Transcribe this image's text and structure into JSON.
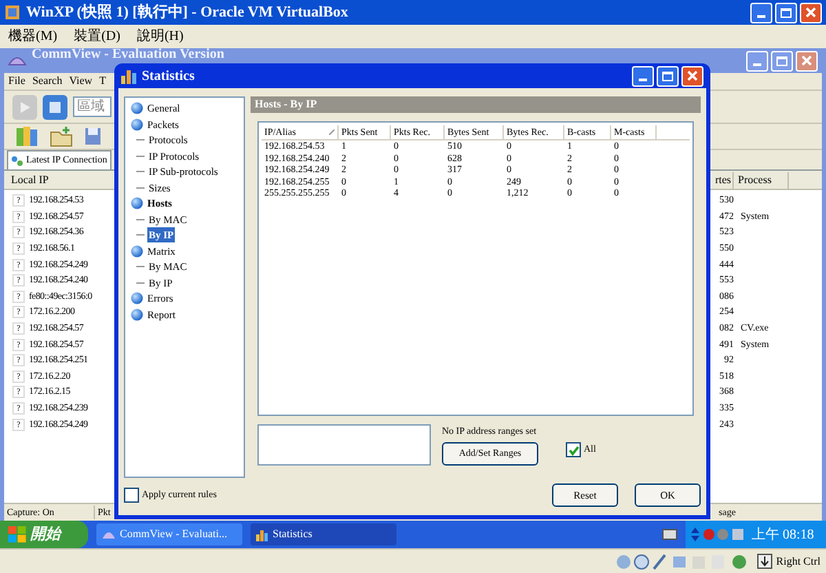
{
  "vbox": {
    "title": "WinXP (快照 1) [執行中] - Oracle VM VirtualBox",
    "menu": [
      "機器(M)",
      "裝置(D)",
      "說明(H)"
    ],
    "host_key": "Right Ctrl"
  },
  "commview": {
    "title": "CommView - Evaluation Version",
    "menu": [
      "File",
      "Search",
      "View",
      "T"
    ],
    "adapter_field": "區域",
    "tab": "Latest IP Connection",
    "columns": [
      "Local IP",
      "rtes",
      "Process"
    ],
    "rows": [
      {
        "icon": "?",
        "local_ip": "192.168.254.53",
        "column_2": "530"
      },
      {
        "icon": "?",
        "local_ip": "192.168.254.57",
        "column_2": "472",
        "process": "System"
      },
      {
        "icon": "?",
        "local_ip": "192.168.254.36",
        "column_2": "523"
      },
      {
        "icon": "?",
        "local_ip": "192.168.56.1",
        "column_2": "550"
      },
      {
        "icon": "?",
        "local_ip": "192.168.254.249",
        "column_2": "444"
      },
      {
        "icon": "?",
        "local_ip": "192.168.254.240",
        "column_2": "553"
      },
      {
        "icon": "?",
        "local_ip": "fe80::49ec:3156:0",
        "column_2": "086"
      },
      {
        "icon": "?",
        "local_ip": "172.16.2.200",
        "column_2": "254"
      },
      {
        "icon": "?",
        "local_ip": "192.168.254.57",
        "column_2": "082",
        "process": "CV.exe"
      },
      {
        "icon": "?",
        "local_ip": "192.168.254.57",
        "column_2": "491",
        "process": "System"
      },
      {
        "icon": "?",
        "local_ip": "192.168.254.251",
        "column_2": "92"
      },
      {
        "icon": "?",
        "local_ip": "172.16.2.20",
        "column_2": "518"
      },
      {
        "icon": "?",
        "local_ip": "172.16.2.15",
        "column_2": "368"
      },
      {
        "icon": "?",
        "local_ip": "192.168.254.239",
        "column_2": "335"
      },
      {
        "icon": "?",
        "local_ip": "192.168.254.249",
        "column_2": "243"
      }
    ],
    "status": [
      "Capture: On",
      "Pkt",
      "sage"
    ]
  },
  "statistics": {
    "title": "Statistics",
    "tree": [
      {
        "label": "General",
        "bold": false,
        "selected": false
      },
      {
        "label": "Packets",
        "bold": false,
        "selected": false,
        "children": [
          {
            "label": "Protocols",
            "selected": false
          },
          {
            "label": "IP Protocols",
            "selected": false
          },
          {
            "label": "IP Sub-protocols",
            "selected": false
          },
          {
            "label": "Sizes",
            "selected": false
          }
        ]
      },
      {
        "label": "Hosts",
        "bold": true,
        "selected": false,
        "children": [
          {
            "label": "By MAC",
            "selected": false
          },
          {
            "label": "By IP",
            "selected": true
          }
        ]
      },
      {
        "label": "Matrix",
        "bold": false,
        "selected": false,
        "children": [
          {
            "label": "By MAC",
            "selected": false
          },
          {
            "label": "By IP",
            "selected": false
          }
        ]
      },
      {
        "label": "Errors",
        "bold": false,
        "selected": false
      },
      {
        "label": "Report",
        "bold": false,
        "selected": false
      }
    ],
    "header": "Hosts - By IP",
    "table": {
      "columns": [
        "IP/Alias",
        "Pkts Sent",
        "Pkts Rec.",
        "Bytes Sent",
        "Bytes Rec.",
        "B-casts",
        "M-casts"
      ],
      "rows": [
        [
          "192.168.254.53",
          "1",
          "0",
          "510",
          "0",
          "1",
          "0"
        ],
        [
          "192.168.254.240",
          "2",
          "0",
          "628",
          "0",
          "2",
          "0"
        ],
        [
          "192.168.254.249",
          "2",
          "0",
          "317",
          "0",
          "2",
          "0"
        ],
        [
          "192.168.254.255",
          "0",
          "1",
          "0",
          "249",
          "0",
          "0"
        ],
        [
          "255.255.255.255",
          "0",
          "4",
          "0",
          "1,212",
          "0",
          "0"
        ]
      ]
    },
    "ranges_note": "No IP address ranges set",
    "ranges_button": "Add/Set Ranges",
    "all": {
      "label": "All",
      "checked": true
    },
    "apply": {
      "label": "Apply current rules",
      "checked": false
    },
    "buttons": [
      "Reset",
      "OK"
    ]
  },
  "taskbar": {
    "start": "開始",
    "tasks": [
      {
        "label": "CommView - Evaluati...",
        "selected": false
      },
      {
        "label": "Statistics",
        "selected": true
      }
    ],
    "clock": "上午 08:18"
  }
}
